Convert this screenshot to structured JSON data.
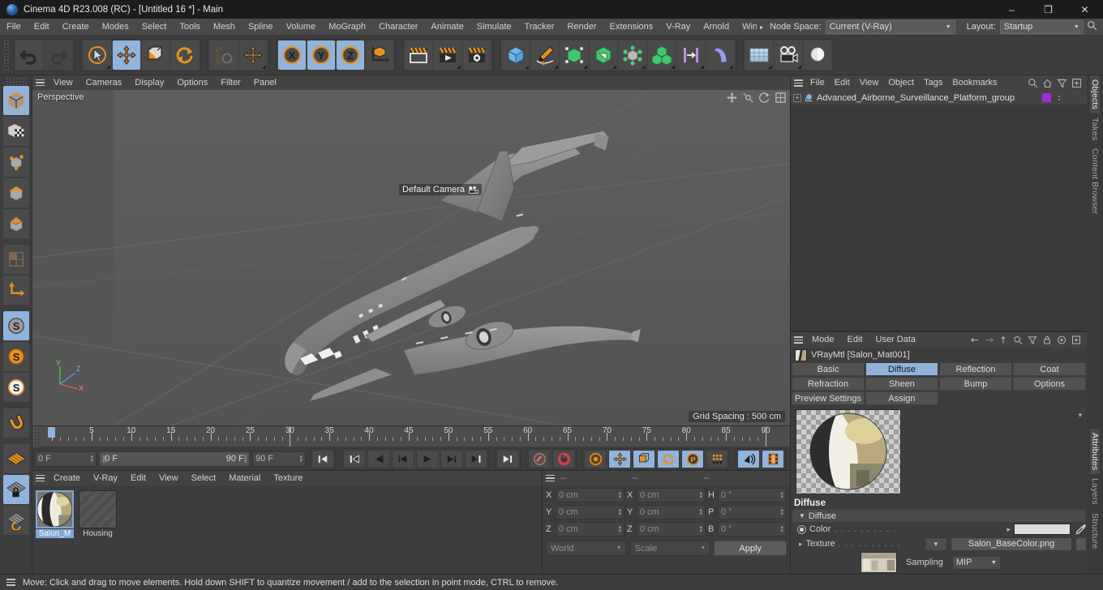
{
  "titlebar": {
    "title": "Cinema 4D R23.008 (RC) - [Untitled 16 *] - Main",
    "minimize": "–",
    "maximize": "❐",
    "close": "✕"
  },
  "menubar": {
    "items": [
      "File",
      "Edit",
      "Create",
      "Modes",
      "Select",
      "Tools",
      "Mesh",
      "Spline",
      "Volume",
      "MoGraph",
      "Character",
      "Animate",
      "Simulate",
      "Tracker",
      "Render",
      "Extensions",
      "V-Ray",
      "Arnold",
      "Window"
    ],
    "overflow_arrow": "▸",
    "node_space_label": "Node Space:",
    "node_space_value": "Current (V-Ray)",
    "layout_label": "Layout:",
    "layout_value": "Startup",
    "search_icon": "search-icon"
  },
  "toolbar": {
    "groups": [
      {
        "name": "history",
        "buttons": [
          {
            "name": "undo-button",
            "icon": "undo-icon",
            "selected": false
          },
          {
            "name": "redo-button",
            "icon": "redo-icon",
            "selected": false,
            "disabled": true
          }
        ]
      },
      {
        "name": "transform",
        "buttons": [
          {
            "name": "live-selection-button",
            "icon": "cursor-circle-icon",
            "selected": false,
            "corner": true
          },
          {
            "name": "move-tool-button",
            "icon": "move-arrows-icon",
            "selected": true
          },
          {
            "name": "scale-tool-button",
            "icon": "scale-box-icon",
            "selected": false
          },
          {
            "name": "rotate-tool-button",
            "icon": "rotate-arrows-icon",
            "selected": false
          }
        ]
      },
      {
        "name": "psr",
        "buttons": [
          {
            "name": "psr-button",
            "icon": "psr-icon",
            "selected": false
          },
          {
            "name": "move-duplicate-button",
            "icon": "move-arrows-icon",
            "selected": false,
            "corner": true
          }
        ]
      },
      {
        "name": "axis-lock",
        "buttons": [
          {
            "name": "lock-x-button",
            "icon": "x-axis-icon",
            "selected": true
          },
          {
            "name": "lock-y-button",
            "icon": "y-axis-icon",
            "selected": true
          },
          {
            "name": "lock-z-button",
            "icon": "z-axis-icon",
            "selected": true
          },
          {
            "name": "world-object-coord-button",
            "icon": "world-coord-icon",
            "selected": false
          }
        ]
      },
      {
        "name": "render",
        "buttons": [
          {
            "name": "render-view-button",
            "icon": "render-view-icon",
            "selected": false
          },
          {
            "name": "render-to-picture-viewer-button",
            "icon": "render-picture-icon",
            "selected": false,
            "corner": true
          },
          {
            "name": "render-settings-button",
            "icon": "render-settings-icon",
            "selected": false
          }
        ]
      },
      {
        "name": "objects",
        "buttons": [
          {
            "name": "add-cube-button",
            "icon": "cube-icon",
            "selected": false,
            "corner": true
          },
          {
            "name": "add-spline-button",
            "icon": "pen-spline-icon",
            "selected": false,
            "corner": true
          },
          {
            "name": "add-generator-button",
            "icon": "generator-icon",
            "selected": false,
            "corner": true
          },
          {
            "name": "add-spline-generator-button",
            "icon": "extrude-icon",
            "selected": false,
            "corner": true
          },
          {
            "name": "add-deformer-button",
            "icon": "deformer-icon",
            "selected": false,
            "corner": true
          },
          {
            "name": "add-array-button",
            "icon": "array-cubes-icon",
            "selected": false,
            "corner": true
          },
          {
            "name": "add-field-button",
            "icon": "field-icon",
            "selected": false,
            "corner": true
          },
          {
            "name": "add-modifier-button",
            "icon": "bend-icon",
            "selected": false,
            "corner": true
          }
        ]
      },
      {
        "name": "scene",
        "buttons": [
          {
            "name": "add-floor-button",
            "icon": "floor-grid-icon",
            "selected": false,
            "corner": true
          },
          {
            "name": "add-camera-button",
            "icon": "camera-icon",
            "selected": false,
            "corner": true
          },
          {
            "name": "add-light-button",
            "icon": "light-bulb-icon",
            "selected": false,
            "corner": true
          }
        ]
      }
    ]
  },
  "leftbar": {
    "buttons": [
      {
        "name": "model-mode-button",
        "icon": "cube-model-icon",
        "selected": true
      },
      {
        "name": "texture-mode-button",
        "icon": "checker-cube-icon",
        "selected": false
      },
      {
        "name": "points-mode-button",
        "icon": "points-cube-icon",
        "selected": false
      },
      {
        "name": "edges-mode-button",
        "icon": "edges-cube-icon",
        "selected": false
      },
      {
        "name": "polygons-mode-button",
        "icon": "polygons-cube-icon",
        "selected": false
      },
      {
        "name": "uv-mode-button",
        "icon": "uv-grid-icon",
        "selected": false
      },
      {
        "name": "axis-mode-button",
        "icon": "axis-l-icon",
        "selected": false
      },
      {
        "name": "enable-snap-button",
        "icon": "snap-s-gray-icon",
        "selected": true
      },
      {
        "name": "workplane-button",
        "icon": "snap-s-orange-icon",
        "selected": false,
        "corner": true
      },
      {
        "name": "lock-workplane-button",
        "icon": "snap-s-white-icon",
        "selected": false
      },
      {
        "name": "magnet-button",
        "icon": "magnet-icon",
        "selected": false,
        "corner": true
      },
      {
        "name": "grid-plane-button",
        "icon": "grid-orange-icon",
        "selected": false
      },
      {
        "name": "lock-grid-button",
        "icon": "grid-lock-icon",
        "selected": true,
        "corner": true
      },
      {
        "name": "grid-rotate-button",
        "icon": "grid-rotate-icon",
        "selected": false
      }
    ]
  },
  "viewport": {
    "menu": [
      "View",
      "Cameras",
      "Display",
      "Options",
      "Filter",
      "Panel"
    ],
    "label": "Perspective",
    "camera_label": "Default Camera",
    "camera_icon": "camera-small-icon",
    "grid_spacing": "Grid Spacing : 500 cm",
    "axis": {
      "x": "X",
      "y": "Y",
      "z": "Z"
    },
    "tools": [
      "viewport-move-icon",
      "viewport-scale-icon",
      "viewport-rotate-icon",
      "viewport-maximize-icon"
    ],
    "background_color": "#5b5b5b",
    "model_color": "#8a8a8a"
  },
  "timeline": {
    "ticks": [
      0,
      5,
      10,
      15,
      20,
      25,
      30,
      35,
      40,
      45,
      50,
      55,
      60,
      65,
      70,
      75,
      80,
      85,
      90
    ],
    "current_frame": "0 F",
    "range_start": "0 F",
    "range_end": "90 F",
    "end_frame_field": "90 F",
    "frame_field_right": "0 F",
    "playhead_frame": 30,
    "playhead_frame2": 90,
    "cursor_frame": 0,
    "buttons": [
      {
        "name": "go-to-start-button",
        "icon": "skip-start-icon"
      },
      {
        "name": "go-to-previous-key-button",
        "icon": "prev-key-icon"
      },
      {
        "name": "step-back-button",
        "icon": "step-back-icon"
      },
      {
        "name": "play-back-button",
        "icon": "play-back-icon"
      },
      {
        "name": "play-forward-button",
        "icon": "play-forward-icon"
      },
      {
        "name": "step-forward-button",
        "icon": "step-forward-icon"
      },
      {
        "name": "go-to-next-key-button",
        "icon": "next-key-icon"
      },
      {
        "name": "go-to-end-button",
        "icon": "skip-end-icon"
      },
      {
        "name": "record-active-objects-button",
        "icon": "record-key-icon"
      },
      {
        "name": "autokeying-button",
        "icon": "autokey-icon"
      },
      {
        "name": "keyframe-selection-button",
        "icon": "keyframe-gear-icon"
      },
      {
        "name": "position-key-button",
        "icon": "move-key-icon"
      },
      {
        "name": "scale-key-button",
        "icon": "scale-key-icon"
      },
      {
        "name": "rotation-key-button",
        "icon": "rotate-key-icon"
      },
      {
        "name": "parameter-key-button",
        "icon": "param-p-icon"
      },
      {
        "name": "point-level-animation-button",
        "icon": "pla-dots-icon"
      },
      {
        "name": "sound-button",
        "icon": "sound-icon"
      },
      {
        "name": "timeline-button",
        "icon": "film-icon"
      }
    ]
  },
  "materials": {
    "menu": [
      "Create",
      "V-Ray",
      "Edit",
      "View",
      "Select",
      "Material",
      "Texture"
    ],
    "items": [
      {
        "name": "Salon_M",
        "selected": true,
        "empty": false
      },
      {
        "name": "Housing",
        "selected": false,
        "empty": true
      }
    ]
  },
  "coordinates": {
    "headers": [
      "--",
      "--",
      "--"
    ],
    "rows": [
      {
        "a_axis": "X",
        "a_value": "0 cm",
        "b_axis": "X",
        "b_value": "0 cm",
        "c_axis": "H",
        "c_value": "0 °"
      },
      {
        "a_axis": "Y",
        "a_value": "0 cm",
        "b_axis": "Y",
        "b_value": "0 cm",
        "c_axis": "P",
        "c_value": "0 °"
      },
      {
        "a_axis": "Z",
        "a_value": "0 cm",
        "b_axis": "Z",
        "b_value": "0 cm",
        "c_axis": "B",
        "c_value": "0 °"
      }
    ],
    "coord_system": "World",
    "size_mode": "Scale",
    "apply_label": "Apply"
  },
  "objects_panel": {
    "menu": [
      "File",
      "Edit",
      "View",
      "Object",
      "Tags",
      "Bookmarks"
    ],
    "icons": [
      "search-icon",
      "home-icon",
      "filter-icon",
      "add-icon"
    ],
    "items": [
      {
        "name": "Advanced_Airborne_Surveillance_Platform_group",
        "tag_color": "#9b30d9",
        "expand": "+"
      }
    ]
  },
  "attributes_panel": {
    "menu": [
      "Mode",
      "Edit",
      "User Data"
    ],
    "icons": [
      "back-arrow-icon",
      "forward-arrow-icon",
      "up-arrow-icon",
      "search-icon",
      "filter-icon",
      "lock-icon",
      "target-icon",
      "add-icon"
    ],
    "title": "VRayMtl [Salon_Mat001]",
    "tabs": [
      [
        "Basic",
        "Diffuse",
        "Reflection",
        "Coat"
      ],
      [
        "Refraction",
        "Sheen",
        "Bump",
        "Options"
      ],
      [
        "Preview Settings",
        "Assign"
      ]
    ],
    "active_tab": "Diffuse",
    "section_title": "Diffuse",
    "group_label": "Diffuse",
    "color_label": "Color",
    "color_dots": ". . . . . . . . . .",
    "color_value": "#dcdcdc",
    "texture_label": "Texture",
    "texture_dots": ". . . . . . . . . .",
    "texture_value": "Salon_BaseColor.png",
    "sampling_label": "Sampling",
    "sampling_value": "MIP"
  },
  "right_tabs": {
    "upper": [
      "Objects",
      "Takes",
      "Content Browser"
    ],
    "upper_active": "Objects",
    "lower": [
      "Attributes",
      "Layers",
      "Structure"
    ],
    "lower_active": "Attributes"
  },
  "statusbar": {
    "text": "Move: Click and drag to move elements. Hold down SHIFT to quantize movement / add to the selection in point mode, CTRL to remove."
  }
}
